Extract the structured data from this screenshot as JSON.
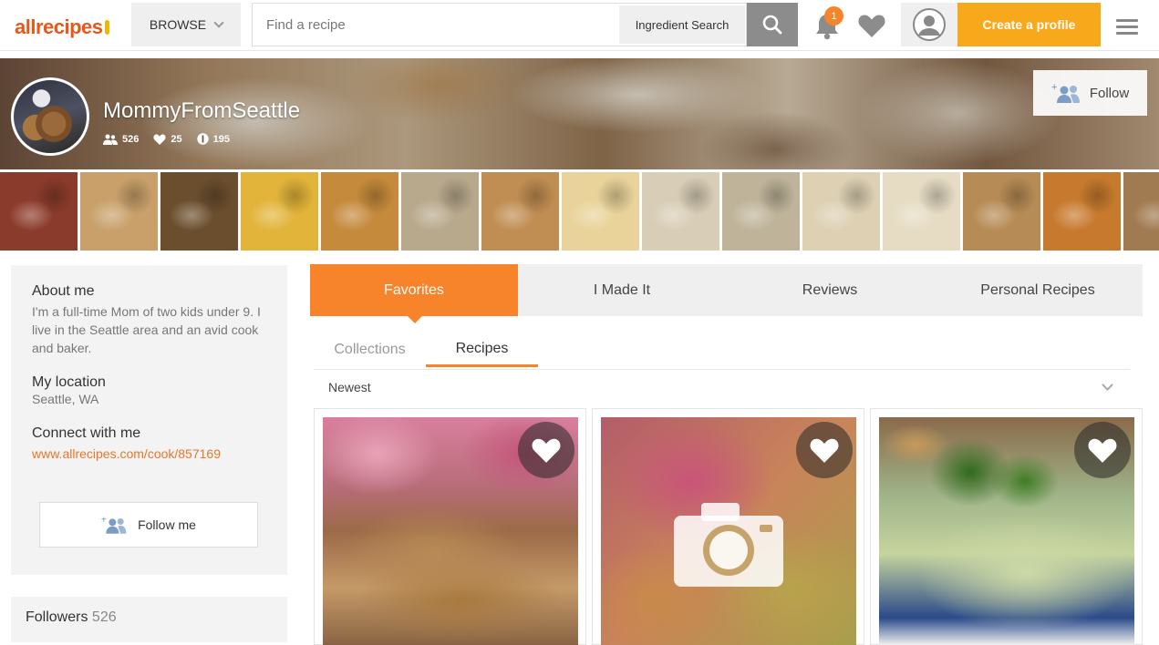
{
  "header": {
    "logo": "allrecipes",
    "browse_label": "BROWSE",
    "search_placeholder": "Find a recipe",
    "ingredient_search_label": "Ingredient Search",
    "notification_count": "1",
    "create_profile_label": "Create a profile"
  },
  "profile": {
    "username": "MommyFromSeattle",
    "followers_count": "526",
    "favorites_count": "25",
    "recipes_count": "195",
    "follow_label": "Follow"
  },
  "photo_strip": [
    {
      "name": "jam-jars",
      "color": "#8b3b2b"
    },
    {
      "name": "crumb-cake",
      "color": "#c9a06a"
    },
    {
      "name": "cookies",
      "color": "#6b4e2e"
    },
    {
      "name": "quiche-slice",
      "color": "#e2b43a"
    },
    {
      "name": "cream-puffs",
      "color": "#c58a3c"
    },
    {
      "name": "braided-bread",
      "color": "#b8a98c"
    },
    {
      "name": "apple-pie",
      "color": "#c08d52"
    },
    {
      "name": "custard-pie",
      "color": "#e9d39a"
    },
    {
      "name": "seeded-rolls",
      "color": "#d8cdb6"
    },
    {
      "name": "seeded-buns",
      "color": "#bfb49a"
    },
    {
      "name": "pasta",
      "color": "#ddd0b3"
    },
    {
      "name": "fresh-pasta",
      "color": "#e6dcc4"
    },
    {
      "name": "twisted-loaf",
      "color": "#b68b55"
    },
    {
      "name": "bread-loaves",
      "color": "#c77a2e"
    },
    {
      "name": "pastry",
      "color": "#a07a50"
    }
  ],
  "about": {
    "about_title": "About me",
    "about_text": "I'm a full-time Mom of two kids under 9. I live in the Seattle area and an avid cook and baker.",
    "location_title": "My location",
    "location": "Seattle, WA",
    "connect_title": "Connect with me",
    "link": "www.allrecipes.com/cook/857169",
    "follow_me_label": "Follow me"
  },
  "followers": {
    "label": "Followers",
    "count": "526"
  },
  "tabs": [
    {
      "label": "Favorites",
      "active": true
    },
    {
      "label": "I Made It",
      "active": false
    },
    {
      "label": "Reviews",
      "active": false
    },
    {
      "label": "Personal Recipes",
      "active": false
    }
  ],
  "subtabs": [
    {
      "label": "Collections",
      "active": false
    },
    {
      "label": "Recipes",
      "active": true
    }
  ],
  "sort": {
    "selected": "Newest"
  },
  "cards": [
    {
      "name": "oatmeal-cookies",
      "placeholder": false
    },
    {
      "name": "no-photo",
      "placeholder": true
    },
    {
      "name": "green-dip",
      "placeholder": false
    }
  ],
  "colors": {
    "accent_orange": "#f7832b",
    "create_yellow": "#f7a81b",
    "link_orange": "#e8762c"
  }
}
